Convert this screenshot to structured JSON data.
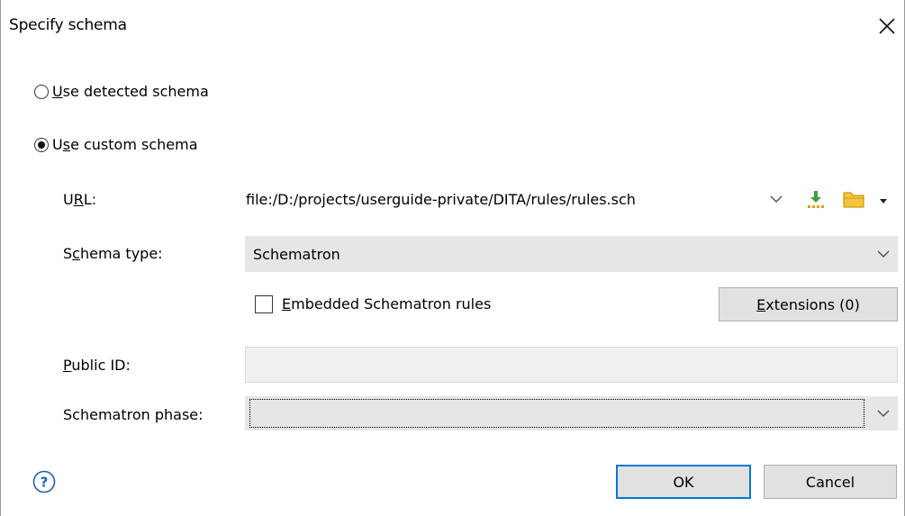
{
  "dialog": {
    "title": "Specify schema",
    "close_icon": "close-x-icon"
  },
  "options": {
    "detected": {
      "prefix": "",
      "mnemonic": "U",
      "rest": "se detected schema",
      "selected": false
    },
    "custom": {
      "prefix": "U",
      "mnemonic": "s",
      "rest": "e custom schema",
      "selected": true
    }
  },
  "url": {
    "label_prefix": "U",
    "label_mnemonic": "R",
    "label_rest": "L:",
    "value": "file:/D:/projects/userguide-private/DITA/rules/rules.sch",
    "insert_icon": "insert-editor-variable-icon",
    "browse_icon": "folder-icon"
  },
  "schema_type": {
    "label_prefix": "S",
    "label_mnemonic": "c",
    "label_rest": "hema type:",
    "value": "Schematron"
  },
  "embedded": {
    "label_prefix": "",
    "label_mnemonic": "E",
    "label_rest": "mbedded Schematron rules",
    "checked": false
  },
  "extensions_button": {
    "prefix": "",
    "mnemonic": "E",
    "rest": "xtensions (0)"
  },
  "public_id": {
    "label_prefix": "",
    "label_mnemonic": "P",
    "label_rest": "ublic ID:",
    "value": ""
  },
  "phase": {
    "label": "Schematron phase:",
    "value": ""
  },
  "footer": {
    "help_icon": "help-icon",
    "ok": "OK",
    "cancel": "Cancel"
  },
  "colors": {
    "default_border": "#0078d7",
    "button_bg": "#e1e1e1",
    "combo_bg": "#e6e6e6"
  }
}
